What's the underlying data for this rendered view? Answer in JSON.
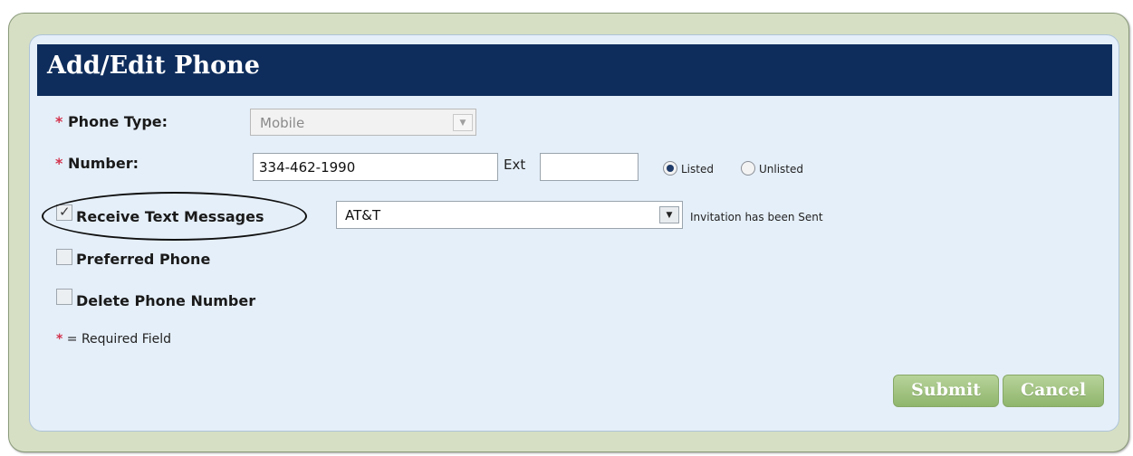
{
  "dialog": {
    "title": "Add/Edit Phone"
  },
  "form": {
    "required_marker": "*",
    "phone_type": {
      "label": "Phone Type:",
      "value": "Mobile"
    },
    "number": {
      "label": "Number:",
      "value": "334-462-1990"
    },
    "ext": {
      "label": "Ext",
      "value": ""
    },
    "listing": {
      "listed_label": "Listed",
      "unlisted_label": "Unlisted",
      "selected": "Listed"
    },
    "receive_text": {
      "label": "Receive Text Messages",
      "checked": true,
      "carrier": "AT&T",
      "status": "Invitation has been Sent"
    },
    "preferred_phone": {
      "label": "Preferred Phone",
      "checked": false
    },
    "delete_phone": {
      "label": "Delete Phone Number",
      "checked": false
    },
    "required_note": "= Required Field"
  },
  "buttons": {
    "submit": "Submit",
    "cancel": "Cancel"
  },
  "colors": {
    "title_bar": "#0e2d5c",
    "required": "#d3334d",
    "button": "#9cc07a",
    "panel": "#e5eff9",
    "frame": "#d6dfc4"
  },
  "icons": {
    "dropdown": "chevron-down-icon",
    "checkbox": "checkbox-icon",
    "radio": "radio-icon"
  }
}
